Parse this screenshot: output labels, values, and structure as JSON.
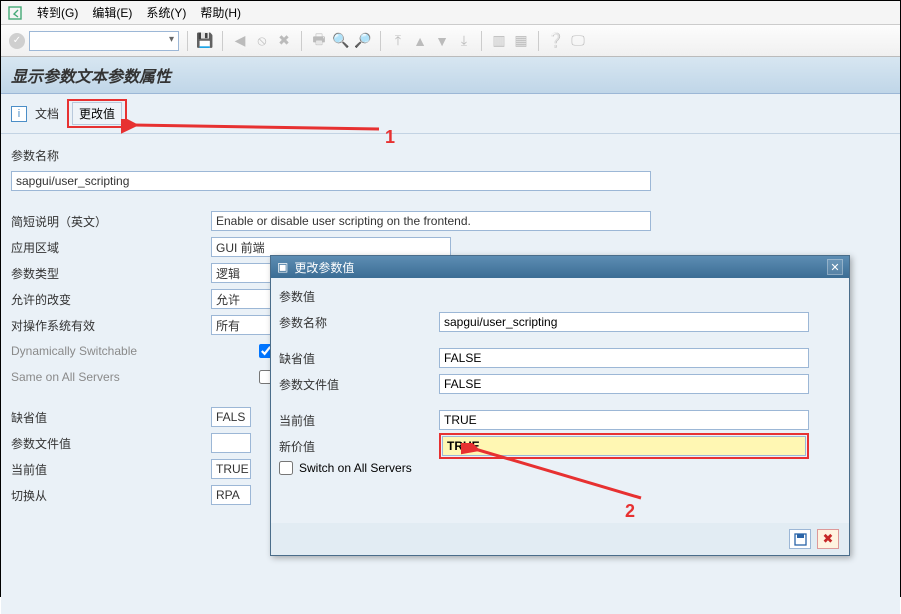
{
  "menubar": {
    "goto": "转到(G)",
    "edit": "编辑(E)",
    "system": "系统(Y)",
    "help": "帮助(H)"
  },
  "page": {
    "title": "显示参数文本参数属性"
  },
  "action_row": {
    "doc_label": "文档",
    "change_btn_label": "更改值"
  },
  "fields": {
    "param_name_label": "参数名称",
    "param_name_value": "sapgui/user_scripting",
    "short_desc_label": "简短说明（英文）",
    "short_desc_value": "Enable or disable user scripting on the frontend.",
    "app_area_label": "应用区域",
    "app_area_value": "GUI 前端",
    "param_type_label": "参数类型",
    "param_type_value": "逻辑",
    "allowed_change_label": "允许的改变",
    "allowed_change_value": "允许",
    "os_valid_label": "对操作系统有效",
    "os_valid_value": "所有",
    "dynamic_label": "Dynamically Switchable",
    "dynamic_checked": true,
    "same_all_label": "Same on All Servers",
    "same_all_checked": false,
    "default_label": "缺省值",
    "default_value": "FALS",
    "param_file_label": "参数文件值",
    "param_file_value": "",
    "current_label": "当前值",
    "current_value": "TRUE",
    "switch_from_label": "切换从",
    "switch_from_value": "RPA"
  },
  "dialog": {
    "title": "更改参数值",
    "section": "参数值",
    "param_name_label": "参数名称",
    "param_name_value": "sapgui/user_scripting",
    "default_label": "缺省值",
    "default_value": "FALSE",
    "param_file_label": "参数文件值",
    "param_file_value": "FALSE",
    "current_label": "当前值",
    "current_value": "TRUE",
    "new_label": "新价值",
    "new_value": "TRUE",
    "switch_all_label": "Switch on All Servers"
  },
  "annotations": {
    "num1": "1",
    "num2": "2"
  }
}
